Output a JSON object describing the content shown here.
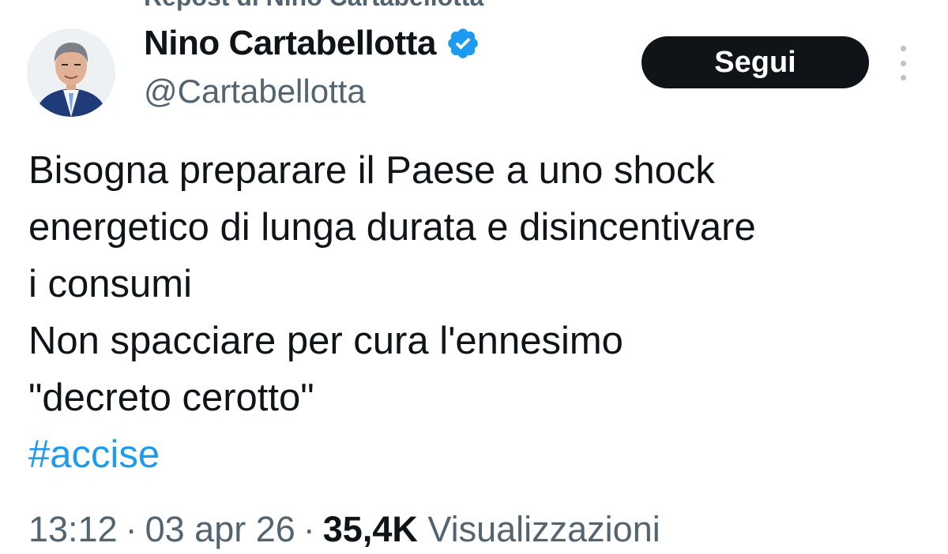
{
  "repost_banner": "Repost di Nino Cartabellotta",
  "author": {
    "display_name": "Nino Cartabellotta",
    "handle": "@Cartabellotta",
    "verified": true,
    "verified_color": "#1d9bf0"
  },
  "follow_button_label": "Segui",
  "tweet": {
    "lines": [
      "Bisogna preparare il Paese a uno shock",
      "energetico di lunga durata e disincentivare",
      "i consumi",
      "Non spacciare per cura l'ennesimo",
      "\"decreto cerotto\""
    ],
    "hashtag": "#accise"
  },
  "meta": {
    "time": "13:12",
    "date": "03 apr 26",
    "separator": "·",
    "views_count": "35,4K",
    "views_label": "Visualizzazioni"
  },
  "colors": {
    "text": "#0f1419",
    "secondary": "#536471",
    "link": "#1d9bf0",
    "button_bg": "#0f1419"
  },
  "icons": {
    "verified": "verified-badge-icon",
    "more": "more-options-icon"
  }
}
